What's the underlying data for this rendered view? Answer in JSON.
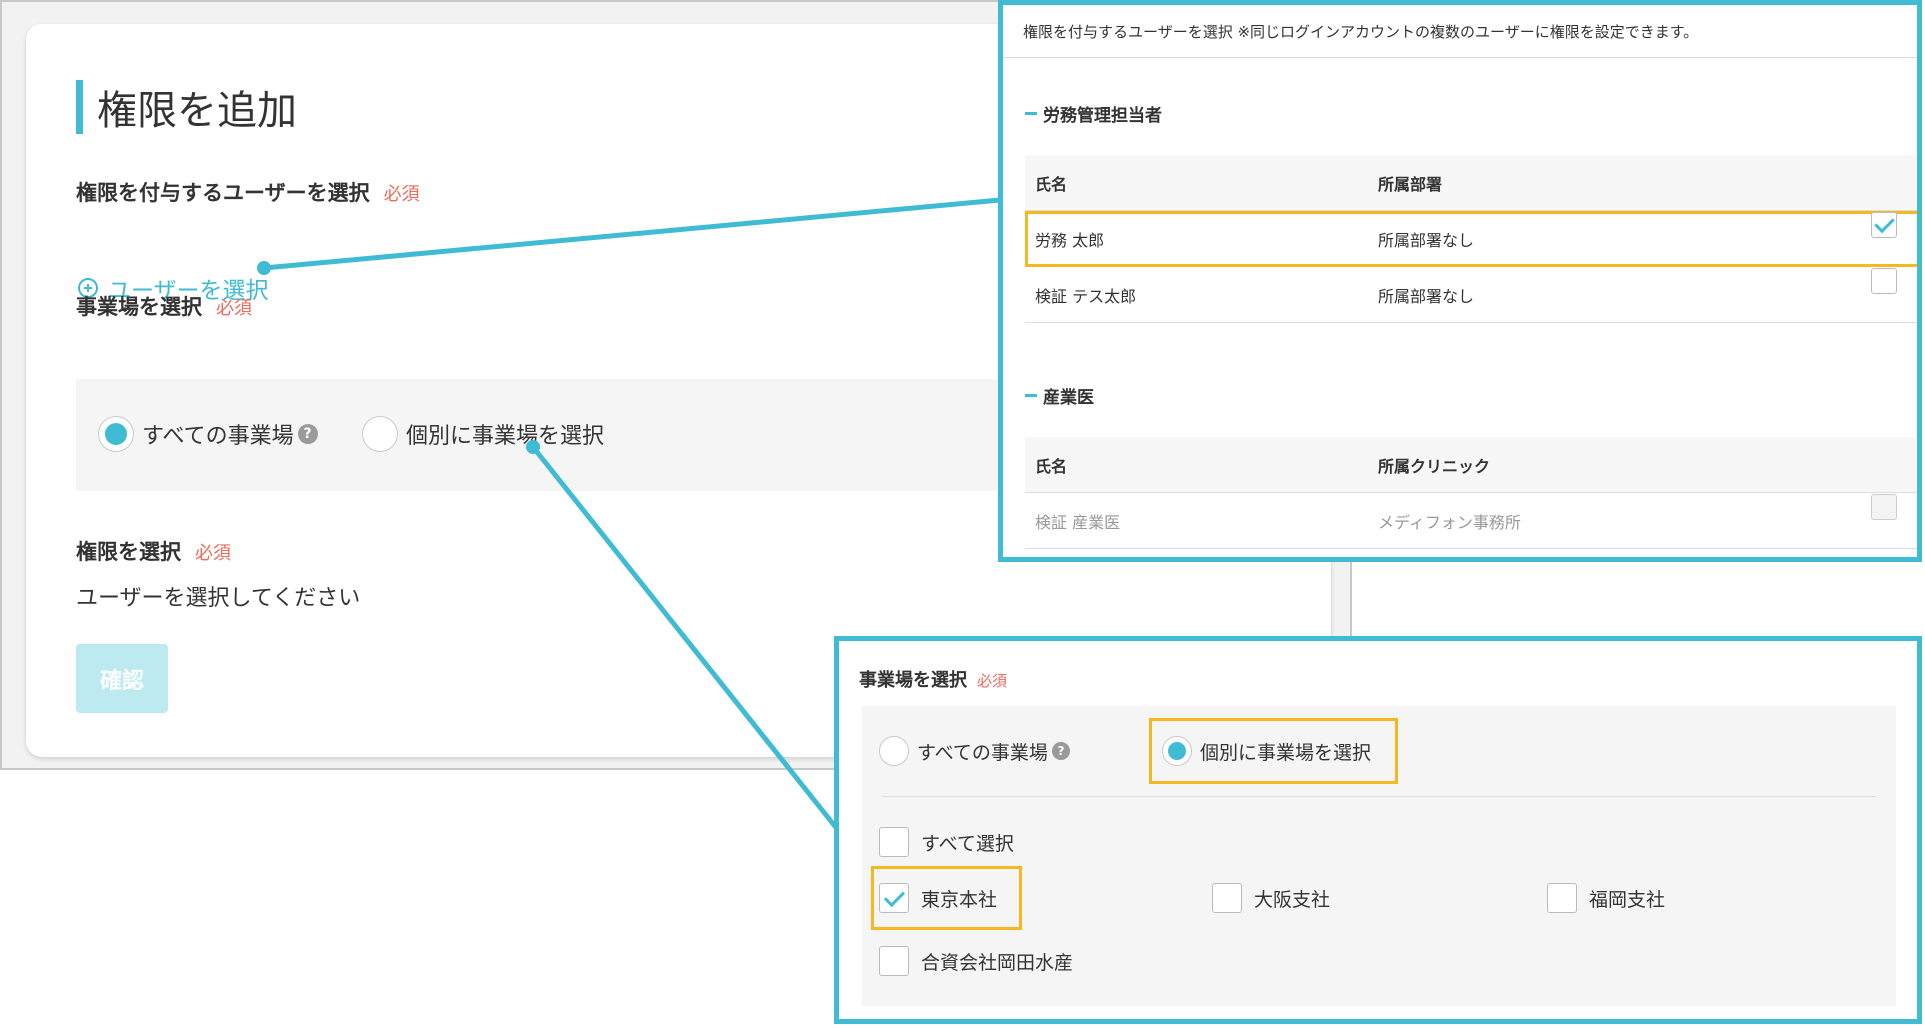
{
  "form": {
    "title": "権限を追加",
    "select_user_label": "権限を付与するユーザーを選択",
    "required": "必須",
    "select_user_link": "ユーザーを選択",
    "site_label": "事業場を選択",
    "site_all": "すべての事業場",
    "site_individual": "個別に事業場を選択",
    "permission_label": "権限を選択",
    "permission_hint": "ユーザーを選択してください",
    "confirm_button": "確認",
    "help_glyph": "?"
  },
  "user_dialog": {
    "note": "権限を付与するユーザーを選択 ※同じログインアカウントの複数のユーザーに権限を設定できます。",
    "groups": [
      {
        "title": "労務管理担当者",
        "col_name": "氏名",
        "col_affiliation": "所属部署",
        "rows": [
          {
            "name": "労務 太郎",
            "affiliation": "所属部署なし",
            "checked": true
          },
          {
            "name": "検証 テス太郎",
            "affiliation": "所属部署なし",
            "checked": false
          }
        ]
      },
      {
        "title": "産業医",
        "col_name": "氏名",
        "col_affiliation": "所属クリニック",
        "rows": [
          {
            "name": "検証 産業医",
            "affiliation": "メディフォン事務所",
            "checked": false,
            "disabled": true
          }
        ]
      }
    ]
  },
  "site_dialog": {
    "label": "事業場を選択",
    "required": "必須",
    "all": "すべての事業場",
    "individual": "個別に事業場を選択",
    "select_all": "すべて選択",
    "sites": [
      {
        "name": "東京本社",
        "checked": true
      },
      {
        "name": "大阪支社",
        "checked": false
      },
      {
        "name": "福岡支社",
        "checked": false
      },
      {
        "name": "合資会社岡田水産",
        "checked": false
      }
    ]
  },
  "colors": {
    "accent": "#3fbcd4",
    "required": "#ef6a5a",
    "highlight": "#f5b820"
  }
}
